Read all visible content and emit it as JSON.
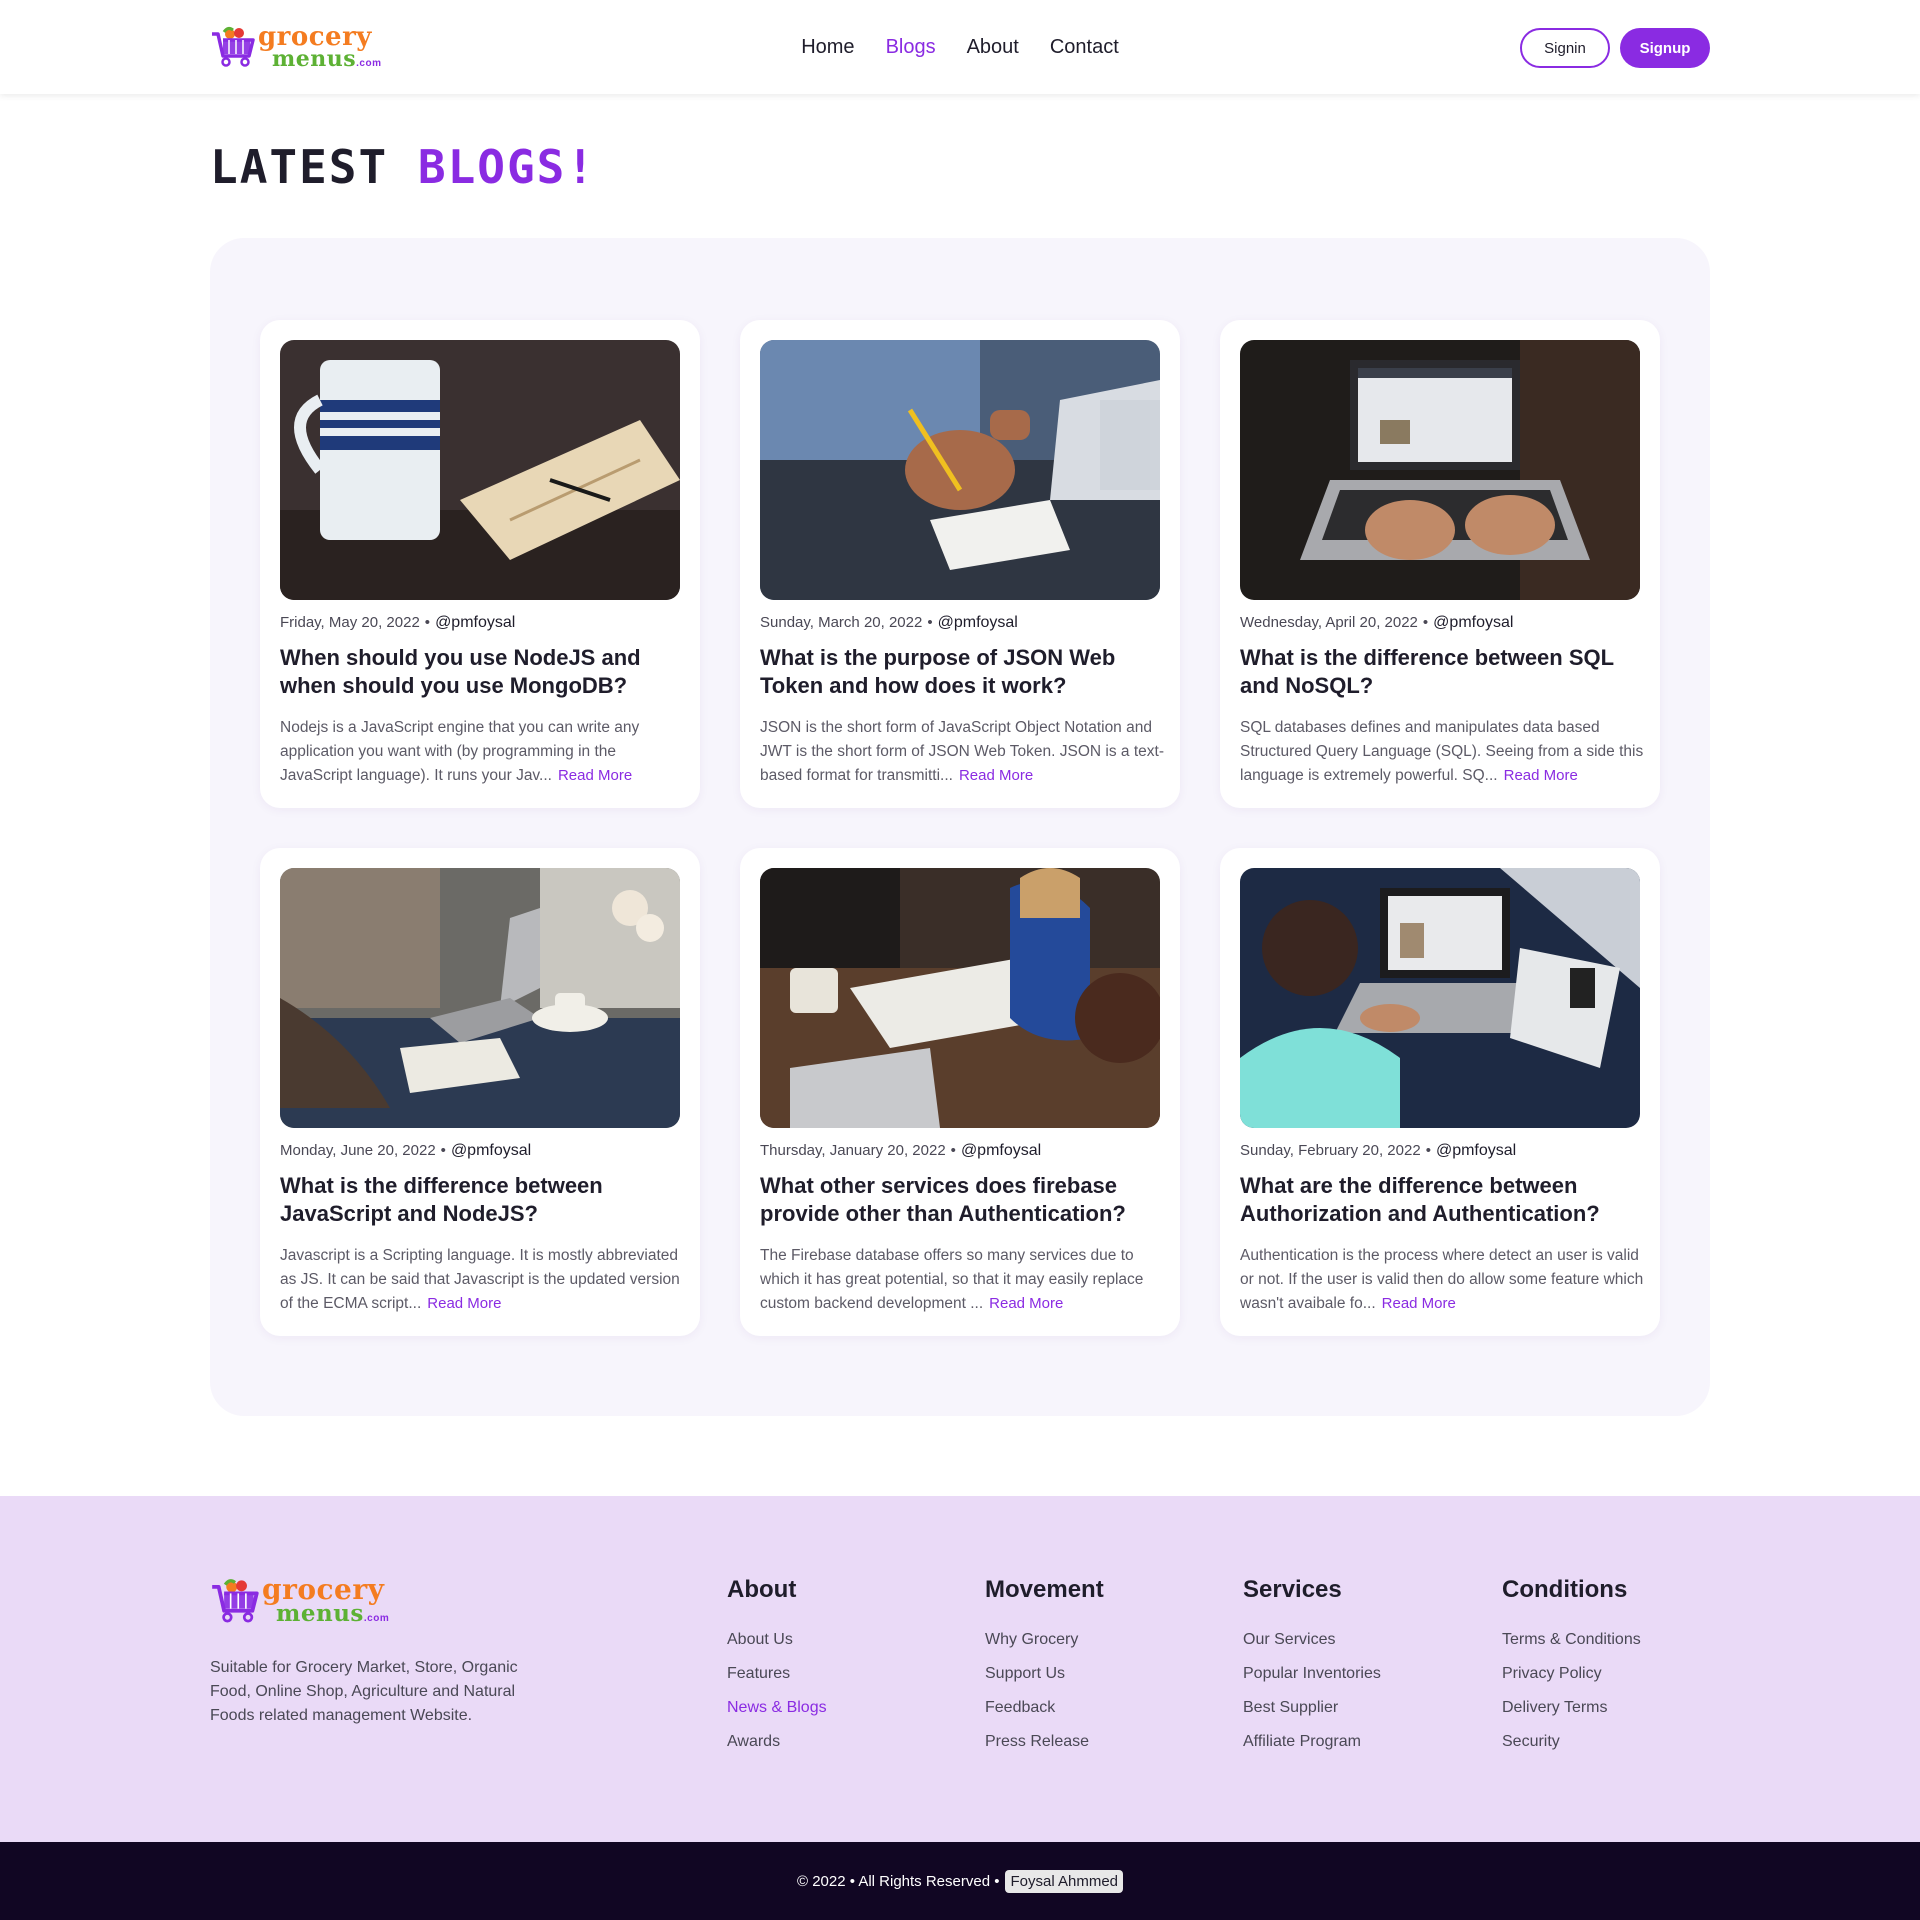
{
  "brand": {
    "word1": "grocery",
    "word2": "menus",
    "tld": ".com",
    "colors": {
      "orange": "#f47c20",
      "green": "#5db134",
      "purple": "#8a2be2"
    }
  },
  "nav": {
    "items": [
      {
        "label": "Home",
        "active": false
      },
      {
        "label": "Blogs",
        "active": true
      },
      {
        "label": "About",
        "active": false
      },
      {
        "label": "Contact",
        "active": false
      }
    ],
    "signin_label": "Signin",
    "signup_label": "Signup"
  },
  "page": {
    "title_prefix": "Latest",
    "title_accent": "Blogs!"
  },
  "blogs": [
    {
      "date": "Friday, May 20, 2022",
      "author": "@pmfoysal",
      "title": "When should you use NodeJS and when should you use MongoDB?",
      "excerpt": "Nodejs is a JavaScript engine that you can write any application you want with (by programming in the JavaScript language). It runs your Jav...",
      "read_more": "Read More",
      "image": "coffee-mug-notebook-photo"
    },
    {
      "date": "Sunday, March 20, 2022",
      "author": "@pmfoysal",
      "title": "What is the purpose of JSON Web Token and how does it work?",
      "excerpt": "JSON is the short form of JavaScript Object Notation and JWT is the short form of JSON Web Token. JSON is a text-based format for transmitti...",
      "read_more": "Read More",
      "image": "person-writing-photo"
    },
    {
      "date": "Wednesday, April 20, 2022",
      "author": "@pmfoysal",
      "title": "What is the difference between SQL and NoSQL?",
      "excerpt": "SQL databases defines and manipulates data based Structured Query Language (SQL). Seeing from a side this language is extremely powerful. SQ...",
      "read_more": "Read More",
      "image": "laptop-typing-photo"
    },
    {
      "date": "Monday, June 20, 2022",
      "author": "@pmfoysal",
      "title": "What is the difference between JavaScript and NodeJS?",
      "excerpt": "Javascript is a Scripting language. It is mostly abbreviated as JS. It can be said that Javascript is the updated version of the ECMA script...",
      "read_more": "Read More",
      "image": "desk-laptop-flowers-photo"
    },
    {
      "date": "Thursday, January 20, 2022",
      "author": "@pmfoysal",
      "title": "What other services does firebase provide other than Authentication?",
      "excerpt": "The Firebase database offers so many services due to which it has great potential, so that it may easily replace custom backend development ...",
      "read_more": "Read More",
      "image": "team-meeting-photo"
    },
    {
      "date": "Sunday, February 20, 2022",
      "author": "@pmfoysal",
      "title": "What are the difference between Authorization and Authentication?",
      "excerpt": "Authentication is the process where detect an user is valid or not. If the user is valid then do allow some feature which wasn't avaibale fo...",
      "read_more": "Read More",
      "image": "woman-laptop-bed-photo"
    }
  ],
  "footer": {
    "description": "Suitable for Grocery Market, Store, Organic Food, Online Shop, Agriculture and Natural Foods related management Website.",
    "columns": [
      {
        "heading": "About",
        "links": [
          {
            "label": "About Us",
            "active": false
          },
          {
            "label": "Features",
            "active": false
          },
          {
            "label": "News & Blogs",
            "active": true
          },
          {
            "label": "Awards",
            "active": false
          }
        ]
      },
      {
        "heading": "Movement",
        "links": [
          {
            "label": "Why Grocery",
            "active": false
          },
          {
            "label": "Support Us",
            "active": false
          },
          {
            "label": "Feedback",
            "active": false
          },
          {
            "label": "Press Release",
            "active": false
          }
        ]
      },
      {
        "heading": "Services",
        "links": [
          {
            "label": "Our Services",
            "active": false
          },
          {
            "label": "Popular Inventories",
            "active": false
          },
          {
            "label": "Best Supplier",
            "active": false
          },
          {
            "label": "Affiliate Program",
            "active": false
          }
        ]
      },
      {
        "heading": "Conditions",
        "links": [
          {
            "label": "Terms & Conditions",
            "active": false
          },
          {
            "label": "Privacy Policy",
            "active": false
          },
          {
            "label": "Delivery Terms",
            "active": false
          },
          {
            "label": "Security",
            "active": false
          }
        ]
      }
    ],
    "copyright": "© 2022 • All Rights Reserved •",
    "owner": "Foysal Ahmmed"
  }
}
